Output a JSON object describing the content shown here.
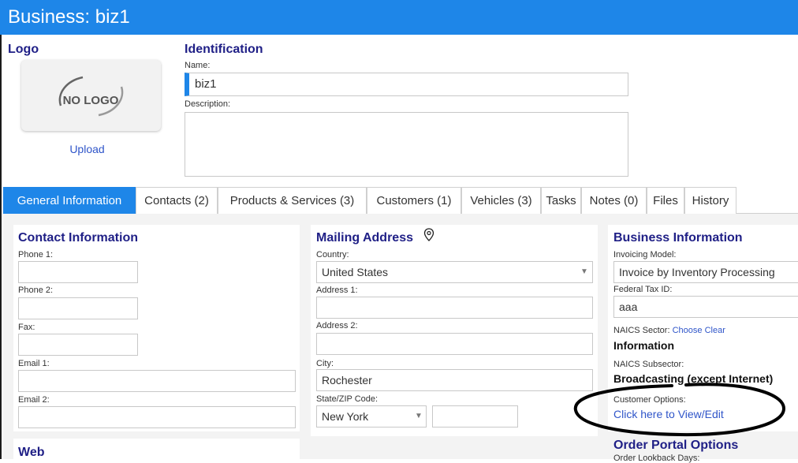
{
  "title": "Business: biz1",
  "logo": {
    "heading": "Logo",
    "placeholder_text": "NO LOGO",
    "upload_label": "Upload"
  },
  "identification": {
    "heading": "Identification",
    "name_label": "Name:",
    "name_value": "biz1",
    "description_label": "Description:",
    "description_value": ""
  },
  "tabs": [
    {
      "label": "General Information",
      "active": true
    },
    {
      "label": "Contacts (2)"
    },
    {
      "label": "Products & Services (3)"
    },
    {
      "label": "Customers (1)"
    },
    {
      "label": "Vehicles (3)"
    },
    {
      "label": "Tasks"
    },
    {
      "label": "Notes (0)"
    },
    {
      "label": "Files"
    },
    {
      "label": "History"
    }
  ],
  "contact": {
    "heading": "Contact Information",
    "phone1_label": "Phone 1:",
    "phone1_value": "",
    "phone2_label": "Phone 2:",
    "phone2_value": "",
    "fax_label": "Fax:",
    "fax_value": "",
    "email1_label": "Email 1:",
    "email1_value": "",
    "email2_label": "Email 2:",
    "email2_value": ""
  },
  "web": {
    "heading": "Web"
  },
  "mailing": {
    "heading": "Mailing Address",
    "country_label": "Country:",
    "country_value": "United States",
    "address1_label": "Address 1:",
    "address1_value": "",
    "address2_label": "Address 2:",
    "address2_value": "",
    "city_label": "City:",
    "city_value": "Rochester",
    "state_zip_label": "State/ZIP Code:",
    "state_value": "New York",
    "zip_value": ""
  },
  "business": {
    "heading": "Business Information",
    "invoicing_label": "Invoicing Model:",
    "invoicing_value": "Invoice by Inventory Processing",
    "tax_label": "Federal Tax ID:",
    "tax_value": "aaa",
    "naics_sector_label": "NAICS Sector:",
    "choose_label": "Choose",
    "clear_label": "Clear",
    "naics_sector_value": "Information",
    "naics_subsector_label": "NAICS Subsector:",
    "naics_subsector_value": "Broadcasting (except Internet)",
    "customer_options_label": "Customer Options:",
    "customer_options_link": "Click here to View/Edit"
  },
  "order_portal": {
    "heading": "Order Portal Options",
    "lookback_label": "Order Lookback Days:"
  }
}
